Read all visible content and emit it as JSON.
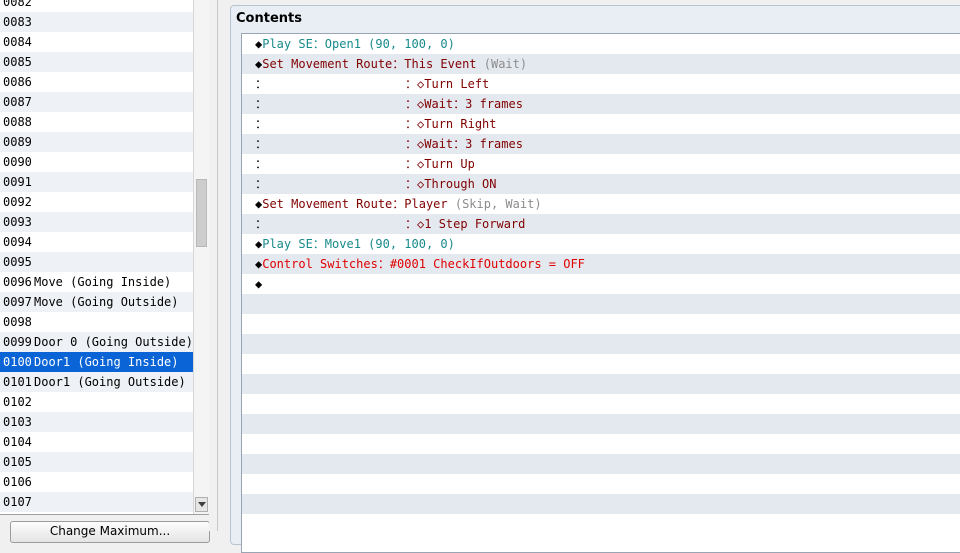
{
  "event_list": {
    "rows": [
      {
        "num": "0082",
        "name": ""
      },
      {
        "num": "0083",
        "name": ""
      },
      {
        "num": "0084",
        "name": ""
      },
      {
        "num": "0085",
        "name": ""
      },
      {
        "num": "0086",
        "name": ""
      },
      {
        "num": "0087",
        "name": ""
      },
      {
        "num": "0088",
        "name": ""
      },
      {
        "num": "0089",
        "name": ""
      },
      {
        "num": "0090",
        "name": ""
      },
      {
        "num": "0091",
        "name": ""
      },
      {
        "num": "0092",
        "name": ""
      },
      {
        "num": "0093",
        "name": ""
      },
      {
        "num": "0094",
        "name": ""
      },
      {
        "num": "0095",
        "name": ""
      },
      {
        "num": "0096",
        "name": "Move (Going Inside)"
      },
      {
        "num": "0097",
        "name": "Move (Going Outside)"
      },
      {
        "num": "0098",
        "name": ""
      },
      {
        "num": "0099",
        "name": "Door 0 (Going Outside)"
      },
      {
        "num": "0100",
        "name": "Door1 (Going Inside)"
      },
      {
        "num": "0101",
        "name": "Door1 (Going Outside)"
      },
      {
        "num": "0102",
        "name": ""
      },
      {
        "num": "0103",
        "name": ""
      },
      {
        "num": "0104",
        "name": ""
      },
      {
        "num": "0105",
        "name": ""
      },
      {
        "num": "0106",
        "name": ""
      },
      {
        "num": "0107",
        "name": ""
      }
    ],
    "selected_index": 18,
    "change_max_label": "Change Maximum..."
  },
  "contents": {
    "title": "Contents",
    "commands": [
      {
        "marker": "◆",
        "parts": [
          {
            "t": "Play SE：Open1 (90, 100, 0)",
            "c": "teal"
          }
        ]
      },
      {
        "marker": "◆",
        "parts": [
          {
            "t": "Set Movement Route：This Event ",
            "c": "maroon"
          },
          {
            "t": "(Wait)",
            "c": "grey"
          }
        ]
      },
      {
        "marker": "：",
        "indent": true,
        "parts": [
          {
            "t": "：◇Turn Left",
            "c": "maroon"
          }
        ]
      },
      {
        "marker": "：",
        "indent": true,
        "parts": [
          {
            "t": "：◇Wait：3 frames",
            "c": "maroon"
          }
        ]
      },
      {
        "marker": "：",
        "indent": true,
        "parts": [
          {
            "t": "：◇Turn Right",
            "c": "maroon"
          }
        ]
      },
      {
        "marker": "：",
        "indent": true,
        "parts": [
          {
            "t": "：◇Wait：3 frames",
            "c": "maroon"
          }
        ]
      },
      {
        "marker": "：",
        "indent": true,
        "parts": [
          {
            "t": "：◇Turn Up",
            "c": "maroon"
          }
        ]
      },
      {
        "marker": "：",
        "indent": true,
        "parts": [
          {
            "t": "：◇Through ON",
            "c": "maroon"
          }
        ]
      },
      {
        "marker": "◆",
        "parts": [
          {
            "t": "Set Movement Route：Player ",
            "c": "maroon"
          },
          {
            "t": "(Skip, Wait)",
            "c": "grey"
          }
        ]
      },
      {
        "marker": "：",
        "indent": true,
        "parts": [
          {
            "t": "：◇1 Step Forward",
            "c": "maroon"
          }
        ]
      },
      {
        "marker": "◆",
        "parts": [
          {
            "t": "Play SE：Move1 (90, 100, 0)",
            "c": "teal"
          }
        ]
      },
      {
        "marker": "◆",
        "parts": [
          {
            "t": "Control Switches：#0001 CheckIfOutdoors = OFF",
            "c": "red"
          }
        ]
      },
      {
        "marker": "◆",
        "parts": []
      }
    ],
    "empty_rows": 12
  },
  "colors": {
    "teal": "#178a8a",
    "maroon": "#800000",
    "red": "#e00000",
    "grey": "#8c8c8c",
    "selection": "#0a64d6"
  }
}
